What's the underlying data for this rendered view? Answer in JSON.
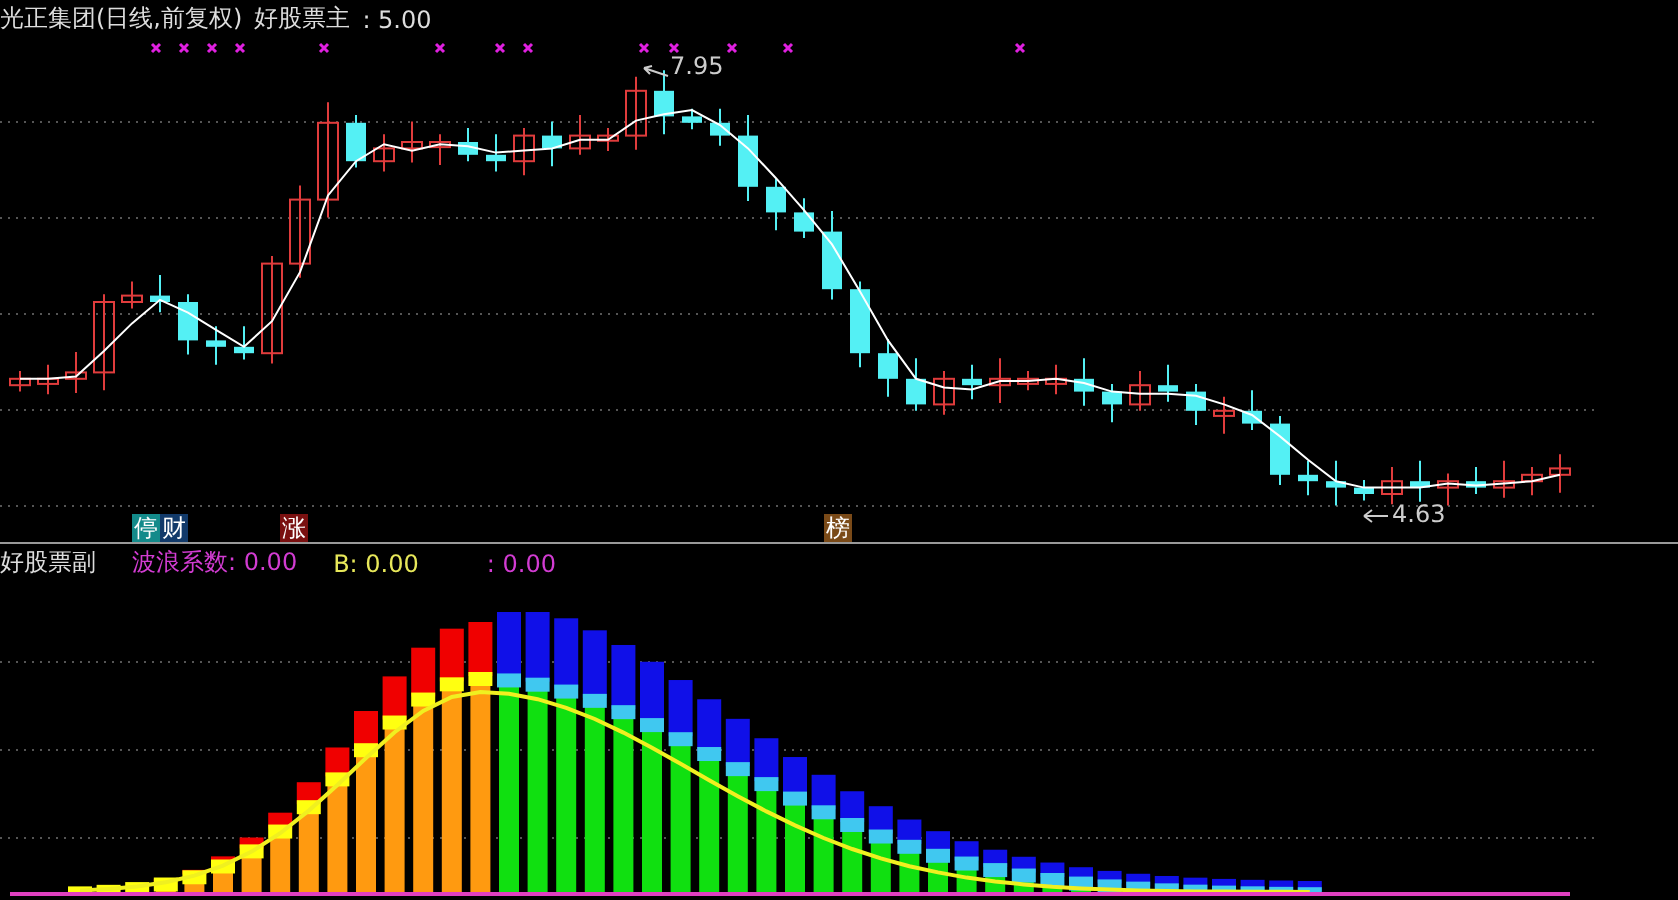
{
  "main_panel": {
    "title": "光正集团(日线,前复权)",
    "indicator": "好股票主",
    "indicator_value": ": 5.00",
    "high_label": "7.95",
    "low_label": "4.63",
    "tag_groups": [
      [
        {
          "text": "停",
          "color": "#138a8a"
        },
        {
          "text": "财",
          "color": "#123a6a"
        }
      ],
      [
        {
          "text": "涨",
          "color": "#7a1010"
        }
      ],
      [
        {
          "text": "榜",
          "color": "#7a4a18"
        }
      ]
    ]
  },
  "sub_panel": {
    "title": "好股票副",
    "readings": [
      {
        "label": "波浪系数",
        "value": ": 0.00",
        "color": "#d23cd2"
      },
      {
        "label": "B",
        "value": ": 0.00",
        "color": "#e8e85a"
      },
      {
        "value": ": 0.00",
        "color": "#d23cd2"
      }
    ]
  }
}
